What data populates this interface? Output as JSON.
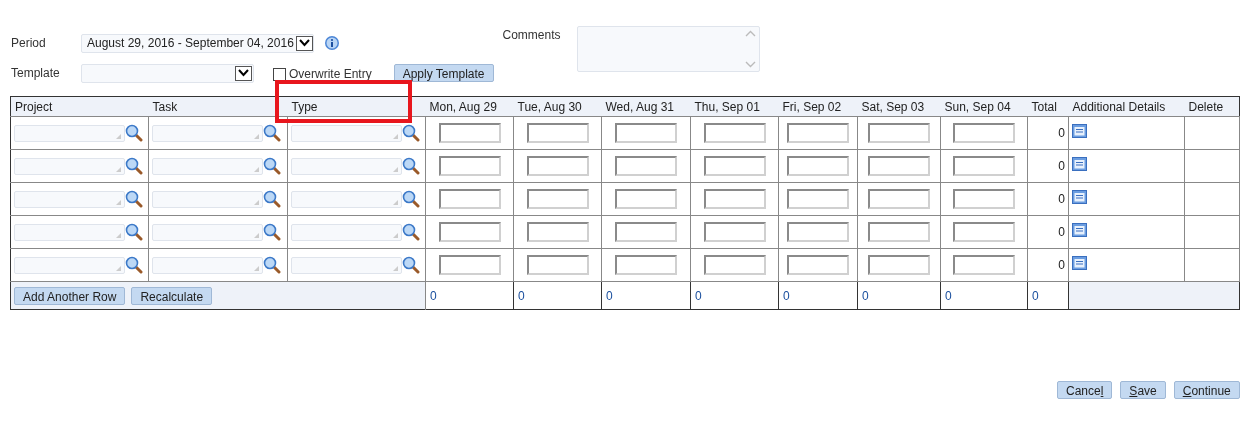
{
  "period": {
    "label": "Period",
    "value": "August 29, 2016 - September 04, 2016"
  },
  "template": {
    "label": "Template"
  },
  "overwrite": {
    "label": "Overwrite Entry",
    "checked": false
  },
  "apply_button": "Apply Template",
  "comments": {
    "label": "Comments"
  },
  "table": {
    "columns": [
      {
        "label": "Project",
        "kind": "lookup",
        "highlighted": false
      },
      {
        "label": "Task",
        "kind": "lookup",
        "highlighted": false
      },
      {
        "label": "Type",
        "kind": "lookup",
        "highlighted": true
      },
      {
        "label": "Mon, Aug 29",
        "kind": "day",
        "highlighted": false
      },
      {
        "label": "Tue, Aug 30",
        "kind": "day",
        "highlighted": false
      },
      {
        "label": "Wed, Aug 31",
        "kind": "day",
        "highlighted": false
      },
      {
        "label": "Thu, Sep 01",
        "kind": "day",
        "highlighted": false
      },
      {
        "label": "Fri, Sep 02",
        "kind": "day",
        "highlighted": false
      },
      {
        "label": "Sat, Sep 03",
        "kind": "day",
        "highlighted": false
      },
      {
        "label": "Sun, Sep 04",
        "kind": "day",
        "highlighted": false
      },
      {
        "label": "Total",
        "kind": "total",
        "highlighted": false
      },
      {
        "label": "Additional Details",
        "kind": "details",
        "highlighted": false
      },
      {
        "label": "Delete",
        "kind": "delete",
        "highlighted": false
      }
    ],
    "rows": [
      {
        "total": "0"
      },
      {
        "total": "0"
      },
      {
        "total": "0"
      },
      {
        "total": "0"
      },
      {
        "total": "0"
      }
    ],
    "footer": {
      "buttons": [
        "Add Another Row",
        "Recalculate"
      ],
      "totals": [
        "0",
        "0",
        "0",
        "0",
        "0",
        "0",
        "0",
        "0"
      ]
    }
  },
  "actions": [
    {
      "before": "Cance",
      "key": "l"
    },
    {
      "key": "S",
      "after": "ave"
    },
    {
      "key": "C",
      "after": "ontinue"
    }
  ]
}
